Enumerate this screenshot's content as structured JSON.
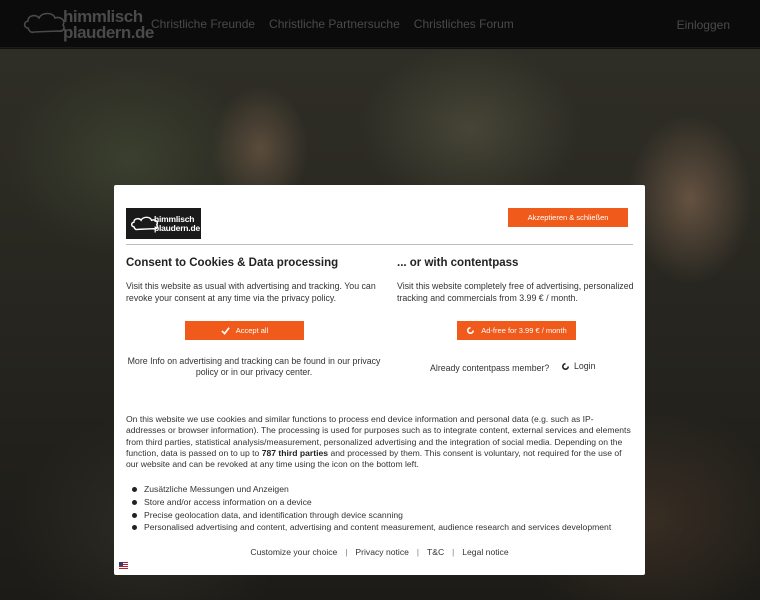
{
  "nav": {
    "logo_line1": "himmlisch",
    "logo_line2": "plaudern.de",
    "links": [
      "Christliche Freunde",
      "Christliche Partnersuche",
      "Christliches Forum"
    ],
    "login": "Einloggen"
  },
  "dialog": {
    "logo_line1": "himmlisch",
    "logo_line2": "plaudern.de",
    "accept_close_label": "Akzeptieren & schließen",
    "left": {
      "title": "Consent to Cookies & Data processing",
      "text": "Visit this website as usual with advertising and tracking. You can revoke your consent at any time via the privacy policy.",
      "button": "Accept all",
      "more_info": "More Info on advertising and tracking can be found in our privacy policy or in our privacy center."
    },
    "right": {
      "title": "... or with contentpass",
      "text": "Visit this website completely free of advertising, personalized tracking and commercials from 3.99 € / month.",
      "button": "Ad-free for 3.99 € / month",
      "already": "Already contentpass member?",
      "login": "Login"
    },
    "body_part1": "On this website we use cookies and similar functions to process end device information and personal data (e.g. such as IP-addresses or browser information). The processing is used for purposes such as to integrate content, external services and elements from third parties, statistical analysis/measurement, personalized advertising and the integration of social media. Depending on the function, data is passed on to up to ",
    "body_bold": "787 third parties",
    "body_part2": " and processed by them. This consent is voluntary, not required for the use of our website and can be revoked at any time using the icon on the bottom left.",
    "purposes": [
      "Zusätzliche Messungen und Anzeigen",
      "Store and/or access information on a device",
      "Precise geolocation data, and identification through device scanning",
      "Personalised advertising and content, advertising and content measurement, audience research and services development"
    ],
    "footer": [
      "Customize your choice",
      "Privacy notice",
      "T&C",
      "Legal notice"
    ],
    "footer_separator": "|"
  },
  "colors": {
    "accent": "#f05a1a",
    "nav_bg": "#0b0b0b"
  }
}
